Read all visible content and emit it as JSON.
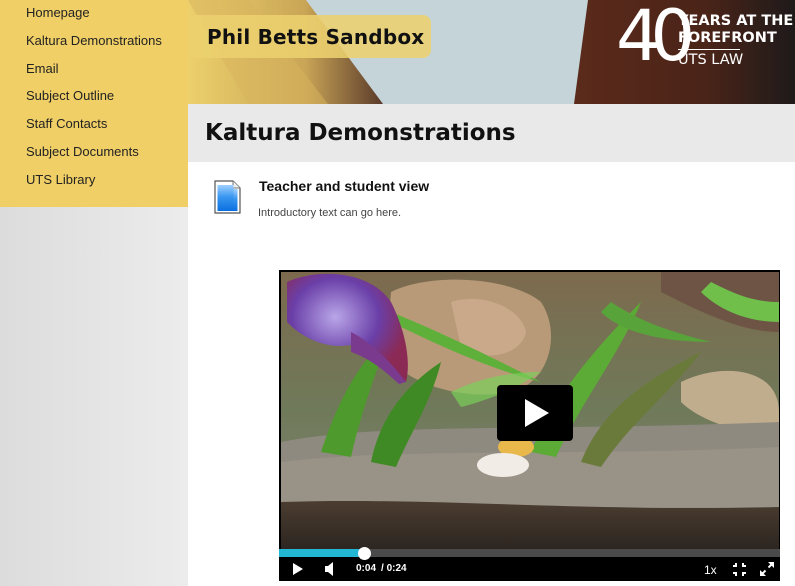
{
  "sidebar": {
    "items": [
      {
        "label": "Homepage"
      },
      {
        "label": "Kaltura Demonstrations"
      },
      {
        "label": "Email"
      },
      {
        "label": "Subject Outline"
      },
      {
        "label": "Staff Contacts"
      },
      {
        "label": "Subject Documents"
      },
      {
        "label": "UTS Library"
      }
    ]
  },
  "header": {
    "site_title": "Phil Betts Sandbox",
    "brand": {
      "number": "40",
      "line1": "YEARS AT THE",
      "line2": "FOREFRONT",
      "line3": "UTS LAW"
    }
  },
  "page": {
    "title": "Kaltura Demonstrations"
  },
  "content": {
    "item": {
      "icon": "document-icon",
      "title": "Teacher and student view",
      "description": "Introductory text can go here."
    }
  },
  "player": {
    "current_time": "0:04",
    "duration": "/ 0:24",
    "progress_fraction": 0.17,
    "speed": "1x",
    "colors": {
      "progress": "#23b7d6",
      "track": "#4a4a4a"
    },
    "icons": {
      "big_play": "play-icon",
      "play": "play-icon",
      "volume": "volume-icon",
      "fullscreen_collapse": "collapse-icon",
      "fullscreen": "expand-icon"
    }
  },
  "colors": {
    "sidebar_accent": "#f0cf66",
    "title_bar": "#e9e9e9"
  }
}
